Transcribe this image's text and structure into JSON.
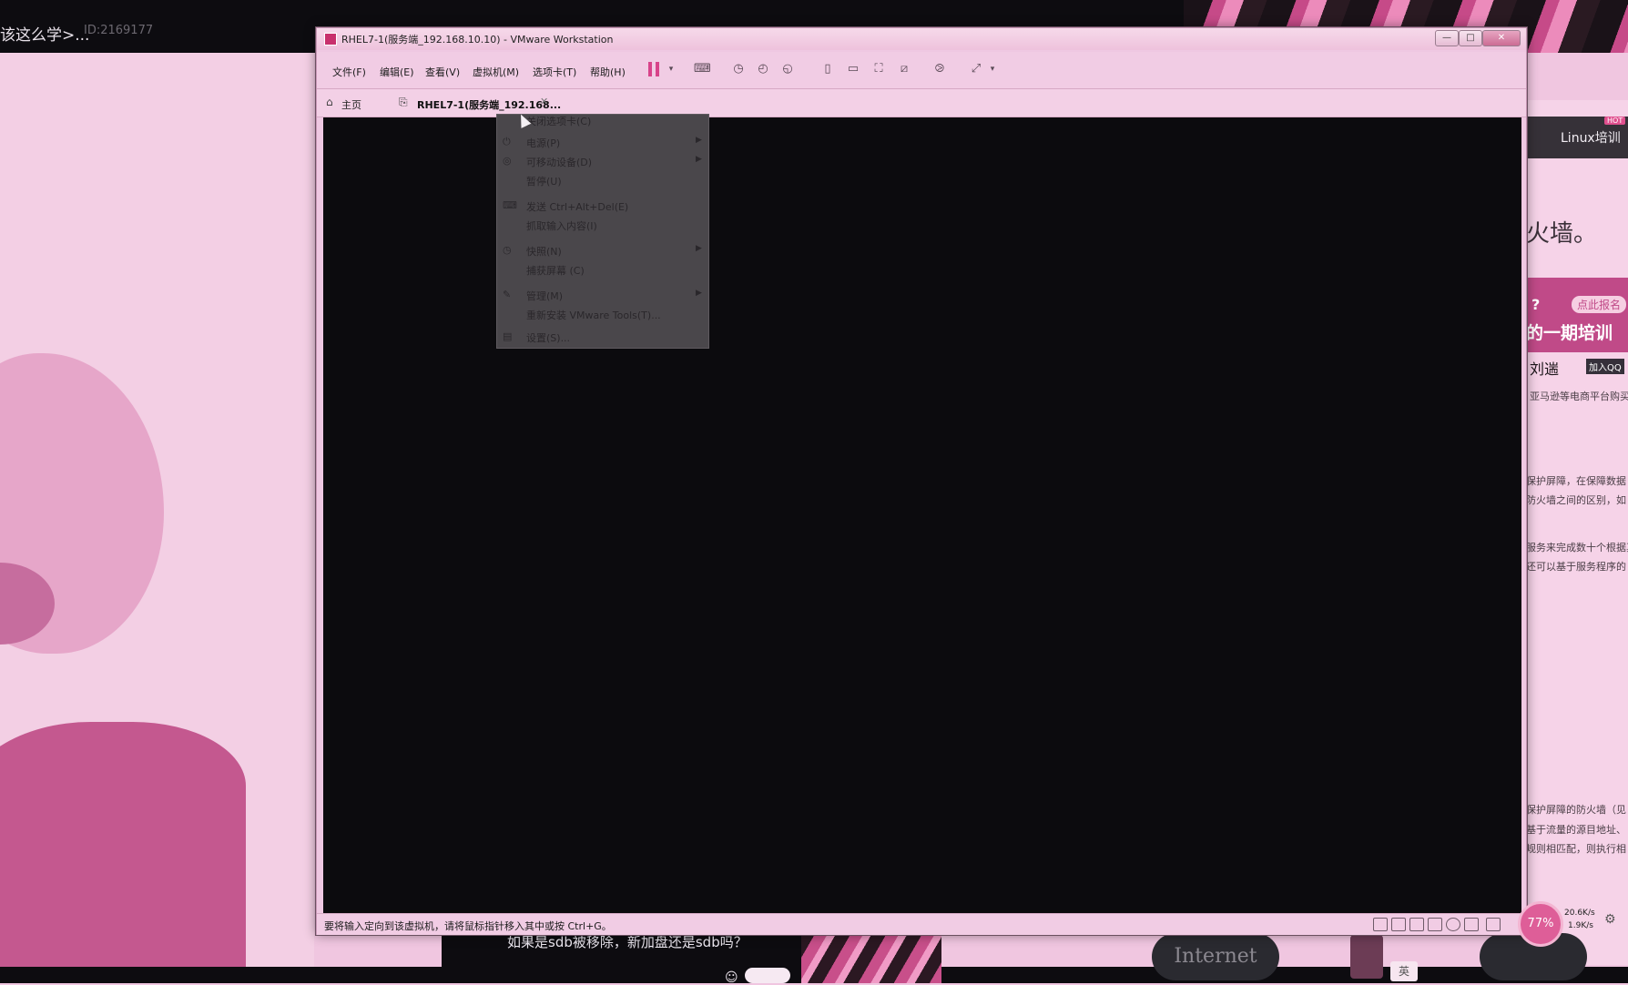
{
  "stream": {
    "title": "该这么学>...",
    "id": "ID:2169177",
    "question": "如果是sdb被移除，新加盘还是sdb吗？",
    "cloud_label": "Internet",
    "input_mode": "英"
  },
  "webpage": {
    "nav_link": "Linux培训",
    "hot_tag": "HOT",
    "heading": "火墙。",
    "promo_q": "?",
    "promo_button": "点此报名",
    "promo_title": "的一期培训",
    "promo_name": "刘遄",
    "promo_qq": "加入QQ",
    "line1": "亚马逊等电商平台购买",
    "line2": "保护屏障，在保障数据",
    "line3": "防火墙之间的区别，如",
    "line4": "服务来完成数十个根据真",
    "line5": "还可以基于服务程序的",
    "line6": "保护屏障的防火墙（见",
    "line7": "基于流量的源目地址、",
    "line8": "规则相匹配，则执行相"
  },
  "window": {
    "title": "RHEL7-1(服务端_192.168.10.10) - VMware Workstation",
    "min": "—",
    "max": "□",
    "close": "✕"
  },
  "menubar": {
    "items": [
      {
        "label": "文件(F)"
      },
      {
        "label": "编辑(E)"
      },
      {
        "label": "查看(V)"
      },
      {
        "label": "虚拟机(M)"
      },
      {
        "label": "选项卡(T)"
      },
      {
        "label": "帮助(H)"
      }
    ]
  },
  "tabs": {
    "home": "主页",
    "vm": "RHEL7-1(服务端_192.168...",
    "close": "✕"
  },
  "context_menu": {
    "items": [
      {
        "label": "关闭选项卡(C)",
        "icon": "",
        "submenu": false
      },
      {
        "label": "电源(P)",
        "icon": "⏻",
        "submenu": true
      },
      {
        "label": "可移动设备(D)",
        "icon": "◎",
        "submenu": true
      },
      {
        "label": "暂停(U)",
        "icon": "",
        "submenu": false
      },
      {
        "label": "发送 Ctrl+Alt+Del(E)",
        "icon": "⌨",
        "submenu": false
      },
      {
        "label": "抓取输入内容(I)",
        "icon": "",
        "submenu": false
      },
      {
        "label": "快照(N)",
        "icon": "◷",
        "submenu": true
      },
      {
        "label": "捕获屏幕 (C)",
        "icon": "",
        "submenu": false
      },
      {
        "label": "管理(M)",
        "icon": "✎",
        "submenu": true
      },
      {
        "label": "重新安装 VMware Tools(T)...",
        "icon": "",
        "submenu": false
      },
      {
        "label": "设置(S)...",
        "icon": "▤",
        "submenu": false
      }
    ]
  },
  "statusbar": {
    "text": "要将输入定向到该虚拟机，请将鼠标指针移入其中或按 Ctrl+G。"
  },
  "network": {
    "percent": "77%",
    "up": "20.6K/s",
    "down": "1.9K/s"
  },
  "colors": {
    "accent": "#d8438a",
    "vm_screen": "#0c0b0e",
    "menu_bg": "#4a474b"
  }
}
